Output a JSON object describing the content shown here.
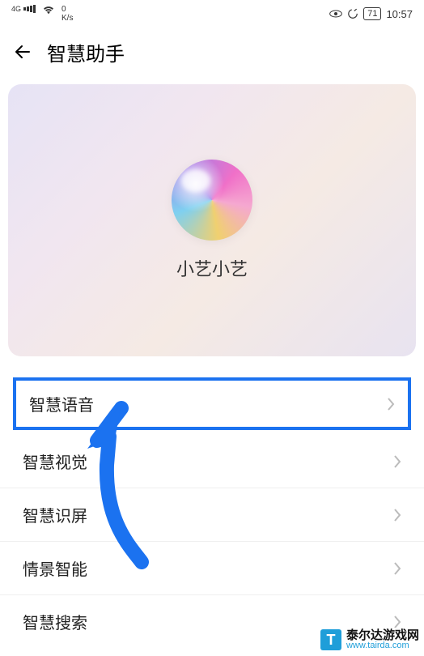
{
  "status": {
    "net_type": "4G",
    "speed_value": "0",
    "speed_unit": "K/s",
    "battery": "71",
    "time": "10:57"
  },
  "header": {
    "title": "智慧助手"
  },
  "hero": {
    "label": "小艺小艺"
  },
  "menu": {
    "items": [
      {
        "label": "智慧语音",
        "highlighted": true
      },
      {
        "label": "智慧视觉",
        "highlighted": false
      },
      {
        "label": "智慧识屏",
        "highlighted": false
      },
      {
        "label": "情景智能",
        "highlighted": false
      },
      {
        "label": "智慧搜索",
        "highlighted": false
      }
    ]
  },
  "watermark": {
    "logo_letter": "T",
    "name": "泰尔达游戏网",
    "url": "www.tairda.com"
  }
}
